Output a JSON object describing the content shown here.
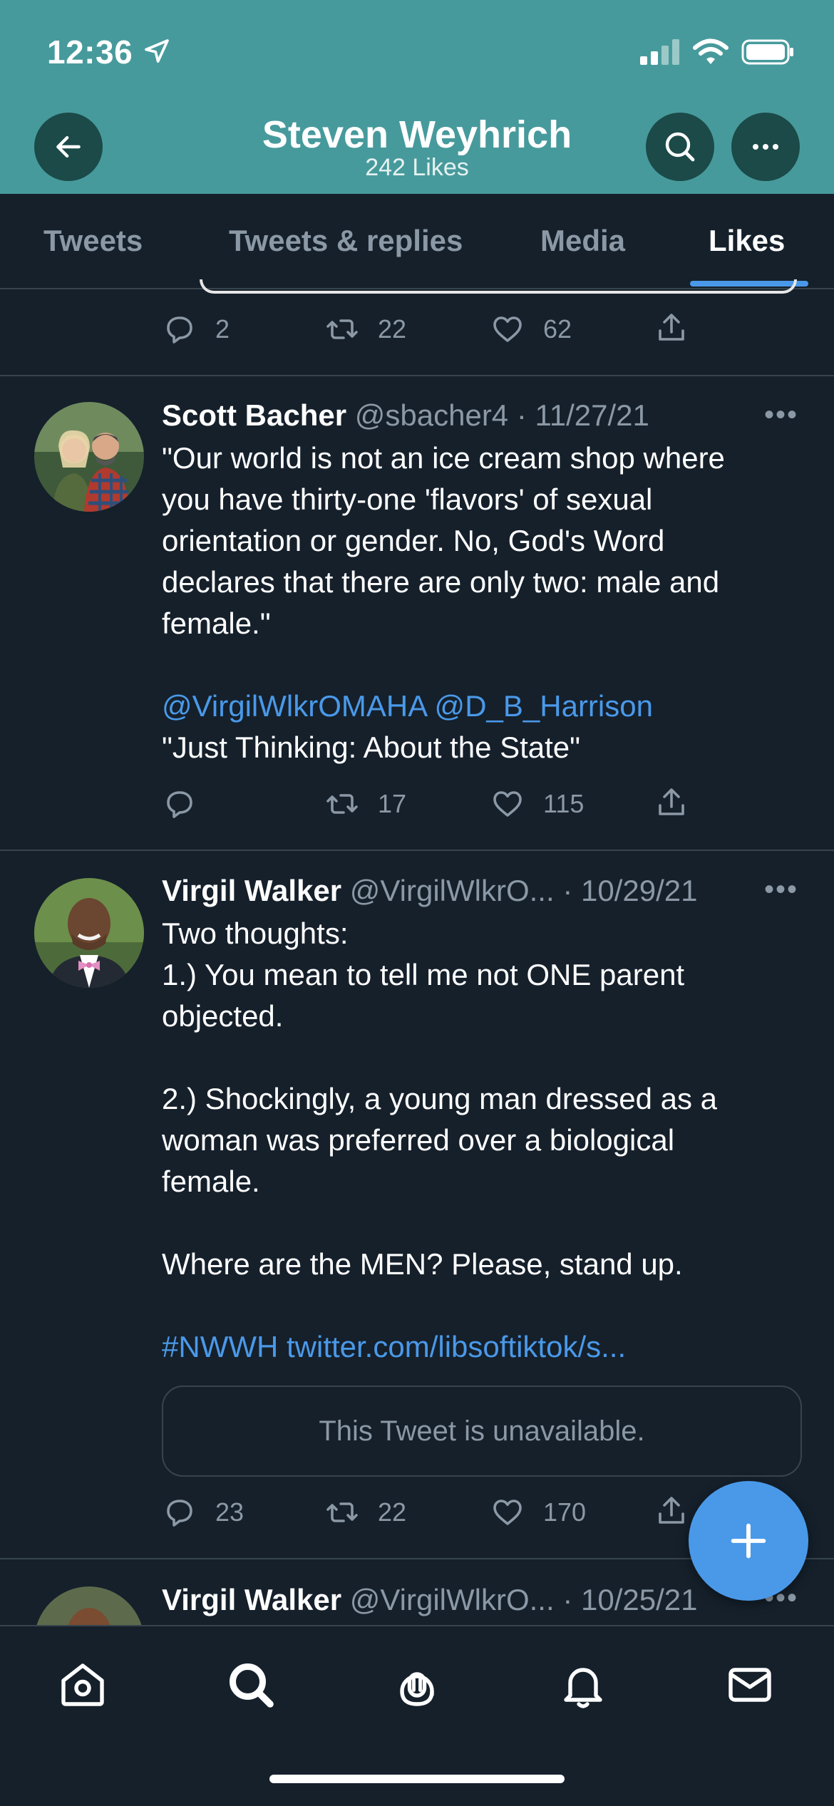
{
  "status": {
    "time": "12:36"
  },
  "header": {
    "title": "Steven Weyhrich",
    "subtitle": "242 Likes"
  },
  "tabs": [
    {
      "label": "Tweets"
    },
    {
      "label": "Tweets & replies"
    },
    {
      "label": "Media"
    },
    {
      "label": "Likes",
      "active": true
    }
  ],
  "prev_tweet": {
    "replies": "2",
    "retweets": "22",
    "likes": "62"
  },
  "tweets": [
    {
      "name": "Scott Bacher",
      "handle": "@sbacher4",
      "date": "· 11/27/21",
      "lines": [
        "\"Our world is not an ice cream shop where",
        "you have thirty-one 'flavors' of sexual",
        "orientation or gender. No, God's Word",
        "declares that there are only two: male and",
        "female.\""
      ],
      "mentions": "@VirgilWlkrOMAHA @D_B_Harrison",
      "last_line": "\"Just Thinking: About the State\"",
      "replies": "",
      "retweets": "17",
      "likes": "115"
    },
    {
      "name": "Virgil Walker",
      "handle": "@VirgilWlkrO...",
      "date": "· 10/29/21",
      "lines": [
        "Two thoughts:",
        "1.) You mean to tell me not ONE parent",
        "objected.",
        "2.) Shockingly, a young man dressed as a",
        "woman was preferred over a biological",
        "female.",
        "Where are the MEN? Please, stand up."
      ],
      "hashtag": "#NWWH",
      "link": "twitter.com/libsoftiktok/s...",
      "quote": "This Tweet is unavailable.",
      "replies": "23",
      "retweets": "22",
      "likes": "170"
    },
    {
      "name": "Virgil Walker",
      "handle": "@VirgilWlkrO...",
      "date": "· 10/25/21"
    }
  ],
  "more_glyph": "•••",
  "colors": {
    "header_bg": "#479a9c",
    "background": "#15202b",
    "accent": "#4a99e9",
    "muted": "#8b98a5"
  }
}
